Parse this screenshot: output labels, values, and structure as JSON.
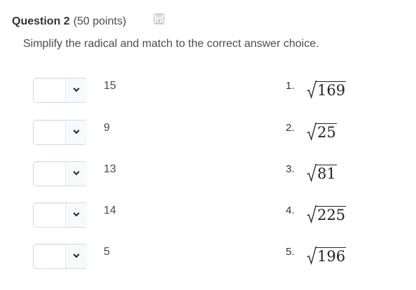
{
  "question": {
    "title": "Question 2",
    "points": "(50 points)",
    "instruction": "Simplify the radical and match to the correct answer choice."
  },
  "rows": [
    {
      "selected": "",
      "answer": "15",
      "number": "1.",
      "radicand": "169"
    },
    {
      "selected": "",
      "answer": "9",
      "number": "2.",
      "radicand": "25"
    },
    {
      "selected": "",
      "answer": "13",
      "number": "3.",
      "radicand": "81"
    },
    {
      "selected": "",
      "answer": "14",
      "number": "4.",
      "radicand": "225"
    },
    {
      "selected": "",
      "answer": "5",
      "number": "5.",
      "radicand": "196"
    }
  ],
  "icons": {
    "save": "save-icon",
    "dropdown": "chevron-down-icon",
    "radical": "square-root-icon"
  },
  "colors": {
    "text": "#494c4e",
    "title": "#333333",
    "border": "#d3d9e3"
  }
}
